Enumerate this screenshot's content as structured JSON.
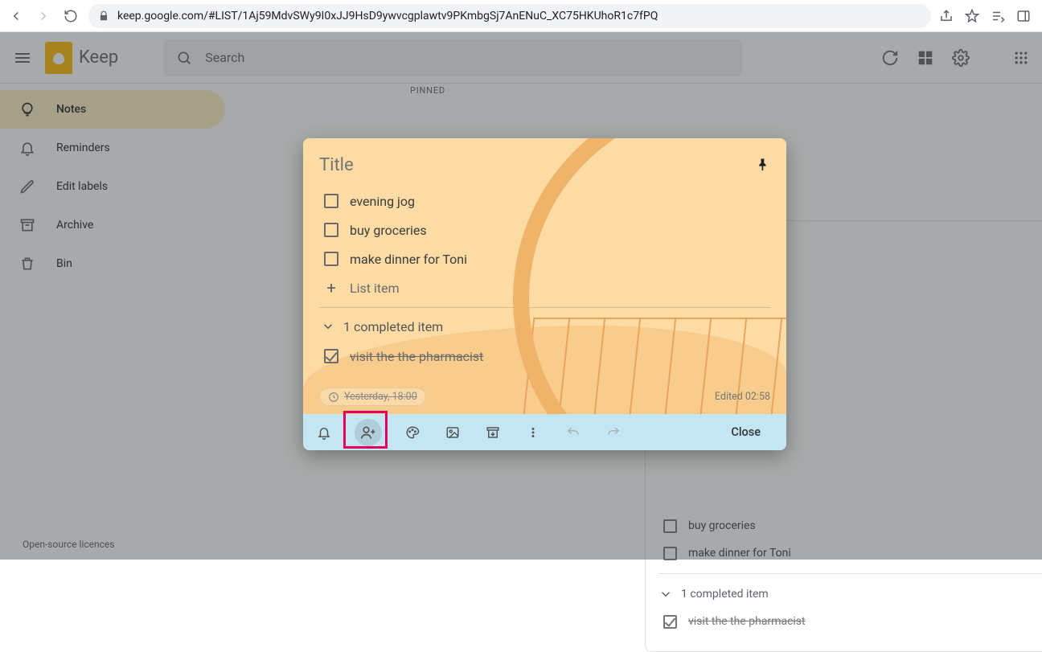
{
  "browser": {
    "url": "keep.google.com/#LIST/1Aj59MdvSWy9I0xJJ9HsD9ywvcgplawtv9PKmbgSj7AnENuC_XC75HKUhoR1c7fPQ"
  },
  "header": {
    "appName": "Keep",
    "searchPlaceholder": "Search"
  },
  "sidebar": {
    "items": [
      {
        "label": "Notes"
      },
      {
        "label": "Reminders"
      },
      {
        "label": "Edit labels"
      },
      {
        "label": "Archive"
      },
      {
        "label": "Bin"
      }
    ]
  },
  "footer": {
    "text": "Open-source licences"
  },
  "pinnedLabel": "PINNED",
  "modal": {
    "titlePlaceholder": "Title",
    "items": [
      {
        "label": "evening jog"
      },
      {
        "label": "buy groceries"
      },
      {
        "label": "make dinner for Toni"
      }
    ],
    "addPlaceholder": "List item",
    "completedHeader": "1 completed item",
    "completed": [
      {
        "label": "visit the the pharmacist"
      }
    ],
    "reminderChip": "Yesterday, 18:00",
    "editedLabel": "Edited 02:58",
    "closeLabel": "Close"
  },
  "bgCard": {
    "items": [
      {
        "label": "buy groceries"
      },
      {
        "label": "make dinner for Toni"
      }
    ],
    "completedHeader": "1 completed item",
    "completed": [
      {
        "label": "visit the the pharmacist"
      }
    ]
  }
}
